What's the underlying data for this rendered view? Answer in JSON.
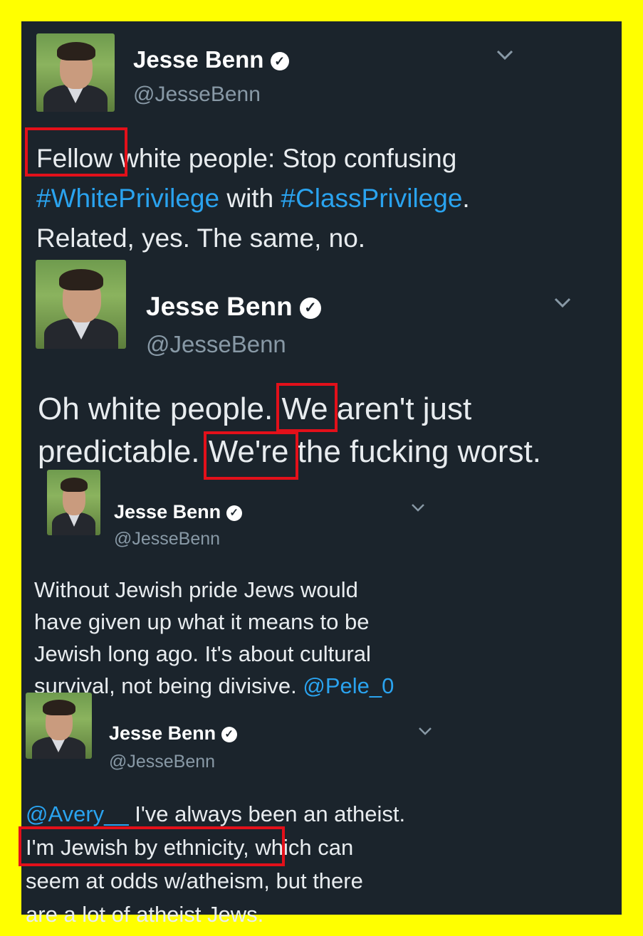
{
  "tweets": [
    {
      "name": "Jesse Benn",
      "handle": "@JesseBenn",
      "lines": [
        [
          {
            "text": "Fellow white people: Stop confusing"
          }
        ],
        [
          {
            "text": "#WhitePrivilege",
            "link": true
          },
          {
            "text": " with "
          },
          {
            "text": "#ClassPrivilege",
            "link": true
          },
          {
            "text": "."
          }
        ],
        [
          {
            "text": "Related, yes. The same, no."
          }
        ]
      ]
    },
    {
      "name": "Jesse Benn",
      "handle": "@JesseBenn",
      "lines": [
        [
          {
            "text": "Oh white people. We aren't just"
          }
        ],
        [
          {
            "text": "predictable. We're the fucking worst."
          }
        ]
      ]
    },
    {
      "name": "Jesse Benn",
      "handle": "@JesseBenn",
      "lines": [
        [
          {
            "text": "Without Jewish pride Jews would"
          }
        ],
        [
          {
            "text": "have given up what it means to be"
          }
        ],
        [
          {
            "text": "Jewish long ago. It's about cultural"
          }
        ],
        [
          {
            "text": "survival, not being divisive. "
          },
          {
            "text": "@Pele_0",
            "link": true
          }
        ]
      ]
    },
    {
      "name": "Jesse Benn",
      "handle": "@JesseBenn",
      "lines": [
        [
          {
            "text": "@Avery__",
            "link": true
          },
          {
            "text": " I've always been an atheist."
          }
        ],
        [
          {
            "text": "I'm Jewish by ethnicity, which can"
          }
        ],
        [
          {
            "text": "seem at odds w/atheism, but there"
          }
        ],
        [
          {
            "text": "are a lot of atheist Jews."
          }
        ]
      ]
    }
  ],
  "icons": {
    "verified": "verified-check-icon",
    "chevron": "chevron-down-icon"
  },
  "colors": {
    "background_frame": "#ffff00",
    "panel": "#1b242c",
    "link": "#2aa3ef",
    "highlight_box": "#e3101a"
  }
}
